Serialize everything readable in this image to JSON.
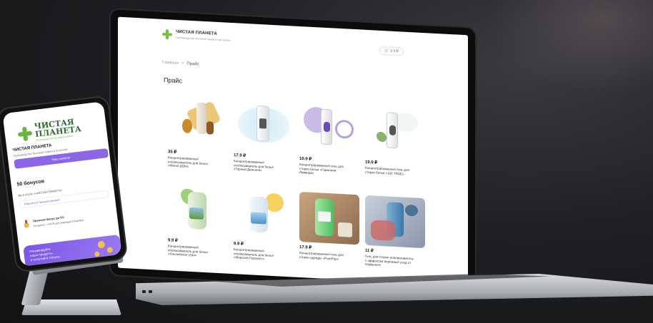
{
  "laptop": {
    "brand": "ЧИСТАЯ ПЛАНЕТА",
    "brand_sub": "Производство бытовой химии в регионах",
    "cart": "3 0 ₽",
    "breadcrumb": [
      "Главная",
      ">",
      "Прайс"
    ],
    "page_title": "Прайс",
    "products": [
      {
        "price": "35 ₽",
        "name": "Концентрированный ополаскиватель для белья «Магия ДОМ»",
        "icon": "golden-bottle"
      },
      {
        "price": "17.9 ₽",
        "name": "Концентрированный ополаскиватель для белья «Горный Дальний»",
        "icon": "white-bottle-water"
      },
      {
        "price": "10.9 ₽",
        "name": "Концентрированный гель для стирки белья «Гармония Лаванда»",
        "icon": "lavender-bottle"
      },
      {
        "price": "19.9 ₽",
        "name": "Концентрированный гель для стирки белья «100 TRUE»",
        "icon": "herb-bottle"
      },
      {
        "price": "9.9 ₽",
        "name": "Концентрированный ополаскиватель для белья «Альпийское утро»",
        "icon": "green-bottle"
      },
      {
        "price": "9.9 ₽",
        "name": "Концентрированный ополаскиватель для белья «Морской Горизонт»",
        "icon": "sun-bottle"
      },
      {
        "price": "17.9 ₽",
        "name": "Концентрированный гель для стирки одежды «PurePop»",
        "icon": "green-canister-photo"
      },
      {
        "price": "11 ₽",
        "name": "Гель для стирки ополаскиватель с эффектом бережный уход от подмышек",
        "icon": "blue-canister-photo"
      }
    ]
  },
  "phone": {
    "brand_line1": "ЧИСТАЯ",
    "brand_line2": "ПЛАНЕТА",
    "tagline": "ПРОИЗВОДСТВО БЫТОВОЙ ХИМИИ",
    "heading": "ЧИСТАЯ ПЛАНЕТА",
    "subheading": "Производство бытовой химии в регионах",
    "primary_button": "Наш каталог",
    "balance": "50 бонусов",
    "note": "Вы в клубе «ЧИСТАЯ ПЛАНЕТА»",
    "link": "Перейти в Личный кабинет",
    "level": "Премиум Бонус до 5%",
    "level_hint": "Потратьте 1 000 ₽ для перехода в Серебро",
    "promo_line1": "Рекомендуйте",
    "promo_line2": "наши продукты",
    "promo_line3": "и получайте бонусы"
  }
}
